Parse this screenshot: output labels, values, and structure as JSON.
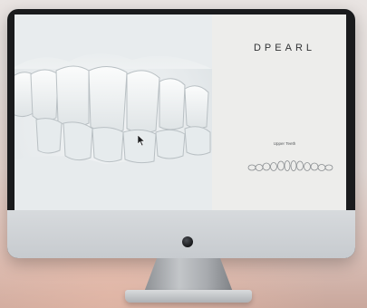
{
  "app": {
    "brand": "DPEARL",
    "view_label": "Upper Teeth"
  },
  "icons": {
    "arch": "upper-teeth-arch-icon",
    "cursor": "mouse-pointer-icon"
  }
}
